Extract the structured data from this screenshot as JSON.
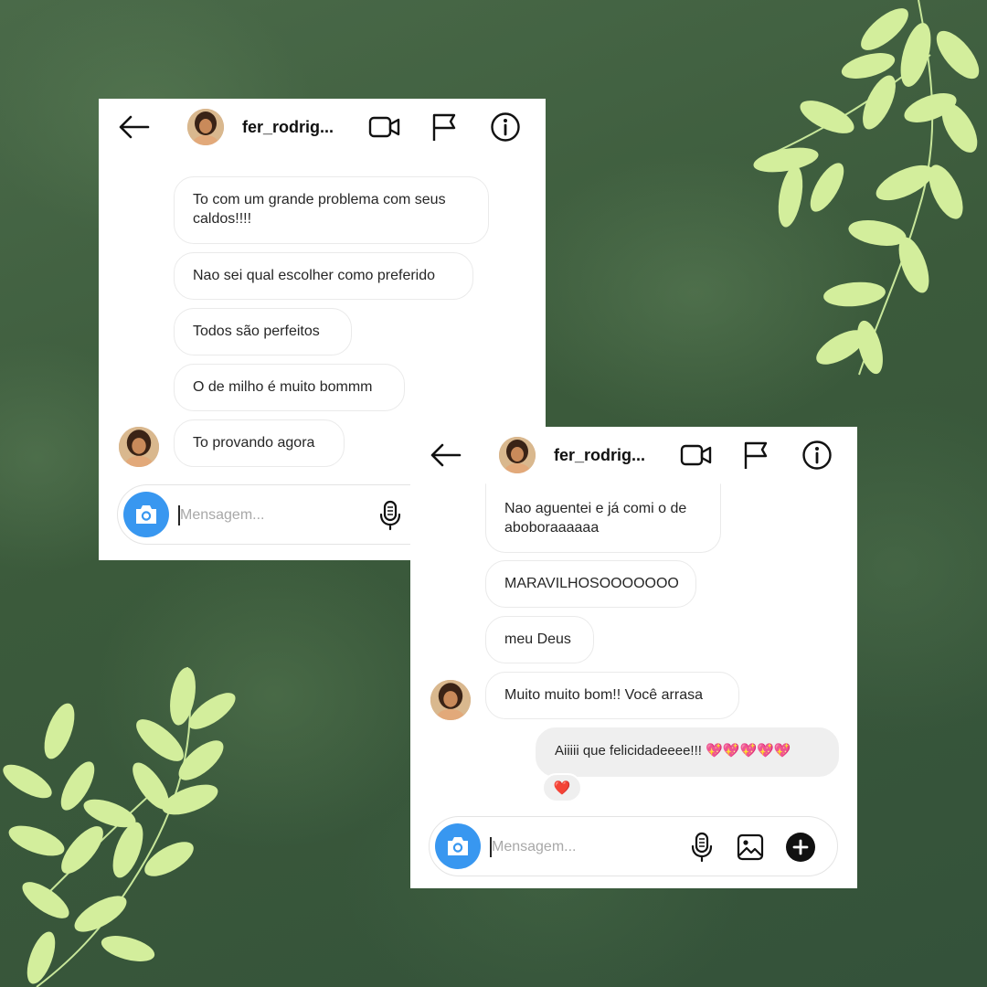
{
  "chat1": {
    "username": "fer_rodrig...",
    "messages": [
      "To com um grande problema com seus\ncaldos!!!!",
      "Nao sei qual escolher como preferido",
      "Todos são perfeitos",
      "O de milho é muito bommm",
      "To provando agora"
    ],
    "composer_placeholder": "Mensagem..."
  },
  "chat2": {
    "username": "fer_rodrig...",
    "messages": [
      "Nao aguentei e já comi o de\naboboraaaaaa",
      "MARAVILHOSOOOOOOO",
      "meu Deus",
      "Muito muito bom!! Você arrasa"
    ],
    "reply": "Aiiiii que felicidadeeee!!! 💖💖💖💖💖",
    "reaction": "❤️",
    "composer_placeholder": "Mensagem..."
  },
  "icons": {
    "back": "back-arrow-icon",
    "video": "video-call-icon",
    "flag": "flag-icon",
    "info": "info-icon",
    "camera": "camera-icon",
    "mic": "microphone-icon",
    "gallery": "gallery-icon",
    "plus": "plus-icon"
  },
  "colors": {
    "background": "#3f5f3f",
    "leaf": "#d3ee9c",
    "camera_button": "#3897f0",
    "incoming_border": "#eaeaea",
    "outgoing_bubble": "#efefef"
  }
}
